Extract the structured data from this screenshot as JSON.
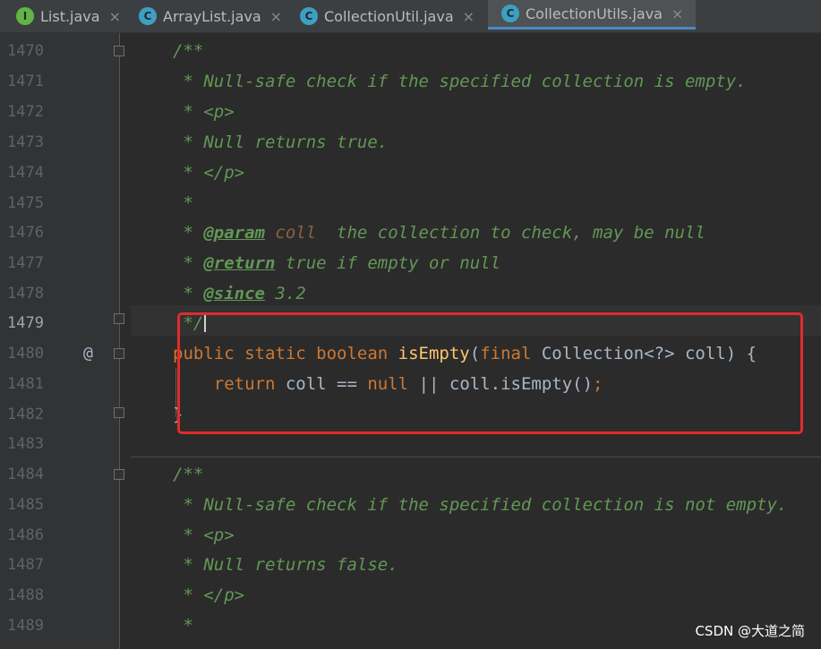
{
  "tabs": [
    {
      "label": "List.java",
      "icon": "interface-icon",
      "icon_letter": "I",
      "active": false
    },
    {
      "label": "ArrayList.java",
      "icon": "class-icon",
      "icon_letter": "C",
      "active": false
    },
    {
      "label": "CollectionUtil.java",
      "icon": "class-icon",
      "icon_letter": "C",
      "active": false
    },
    {
      "label": "CollectionUtils.java",
      "icon": "class-icon",
      "icon_letter": "C",
      "active": true
    }
  ],
  "close_glyph": "×",
  "gutter": {
    "override_marker": "@"
  },
  "lines": [
    {
      "num": "1470",
      "text": "/**"
    },
    {
      "num": "1471",
      "text": " * Null-safe check if the specified collection is empty."
    },
    {
      "num": "1472",
      "text": " * <p>"
    },
    {
      "num": "1473",
      "text": " * Null returns true."
    },
    {
      "num": "1474",
      "text": " * </p>"
    },
    {
      "num": "1475",
      "text": " *"
    },
    {
      "num": "1476",
      "star": " * ",
      "tag": "@param",
      "param": " coll",
      "rest": "  the collection to check, may be null"
    },
    {
      "num": "1477",
      "star": " * ",
      "tag": "@return",
      "rest": " true if empty or null"
    },
    {
      "num": "1478",
      "star": " * ",
      "tag": "@since",
      "rest": " 3.2"
    },
    {
      "num": "1479",
      "text": " */"
    },
    {
      "num": "1480",
      "kw1": "public static boolean ",
      "fn": "isEmpty",
      "p1": "(",
      "kw2": "final ",
      "p2": "Collection<?> coll) {"
    },
    {
      "num": "1481",
      "kw1": "    return ",
      "p1": "coll == ",
      "kw2": "null",
      "p2": " || coll.isEmpty()",
      "semi": ";"
    },
    {
      "num": "1482",
      "text": "}"
    },
    {
      "num": "1483",
      "text": ""
    },
    {
      "num": "1484",
      "text": "/**"
    },
    {
      "num": "1485",
      "text": " * Null-safe check if the specified collection is not empty."
    },
    {
      "num": "1486",
      "text": " * <p>"
    },
    {
      "num": "1487",
      "text": " * Null returns false."
    },
    {
      "num": "1488",
      "text": " * </p>"
    },
    {
      "num": "1489",
      "text": " *"
    }
  ],
  "watermark": "CSDN @大道之简",
  "colors": {
    "comment": "#629755",
    "keyword": "#cc7832",
    "method": "#ffc66d",
    "highlight_box": "#e12b2b",
    "active_tab_underline": "#4a88c7"
  }
}
